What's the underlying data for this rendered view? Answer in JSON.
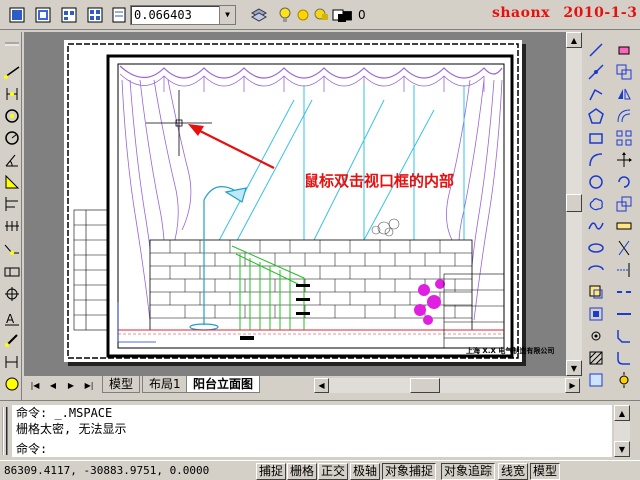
{
  "toolbar": {
    "scale_value": "0.066403",
    "layer_value": "0",
    "watermark_author": "shaonx",
    "watermark_date": "2010-1-3"
  },
  "drawing": {
    "annotation": "鼠标双击视口框的内部",
    "title_block": "上海 X.X 电气制造有限公司"
  },
  "tabs": [
    {
      "label": "模型",
      "active": false
    },
    {
      "label": "布局1",
      "active": false
    },
    {
      "label": "阳台立面图",
      "active": true
    }
  ],
  "command": {
    "history": [
      "命令: _.MSPACE",
      "栅格太密, 无法显示"
    ],
    "prompt": "命令:"
  },
  "status": {
    "coordinates": "86309.4117, -30883.9751, 0.0000",
    "buttons": [
      "捕捉",
      "栅格",
      "正交",
      "极轴",
      "对象捕捉",
      "对象追踪",
      "线宽",
      "模型"
    ]
  },
  "colors": {
    "annotation": "#e8100e",
    "window_bg": "#d4d0c8",
    "drawing_bg": "#808080"
  }
}
